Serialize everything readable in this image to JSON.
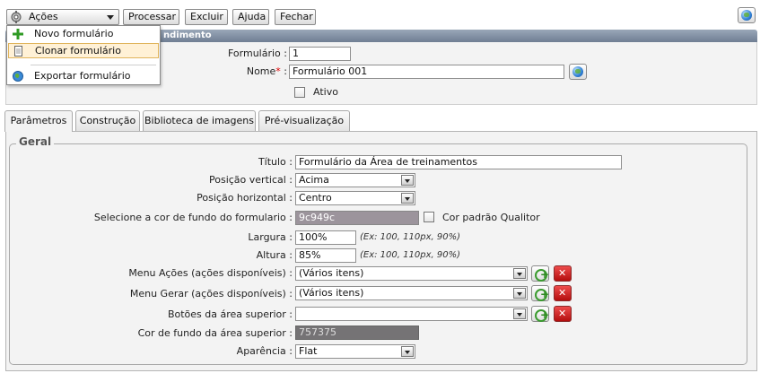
{
  "toolbar": {
    "acoes_label": "Ações",
    "processar_label": "Processar",
    "excluir_label": "Excluir",
    "ajuda_label": "Ajuda",
    "fechar_label": "Fechar"
  },
  "acoes_menu": {
    "items": [
      {
        "label": "Novo formulário",
        "icon": "plus-icon"
      },
      {
        "label": "Clonar formulário",
        "icon": "document-icon",
        "highlighted": true
      },
      {
        "label": "Exportar formulário",
        "icon": "globe-icon"
      }
    ]
  },
  "header": {
    "title": "ndimento"
  },
  "form": {
    "formulario_label": "Formulário :",
    "formulario_value": "1",
    "nome_label": "Nome",
    "nome_required": "*",
    "nome_suffix": " :",
    "nome_value": "Formulário 001",
    "ativo_label": "Ativo"
  },
  "tabs": [
    {
      "label": "Parâmetros",
      "active": true
    },
    {
      "label": "Construção"
    },
    {
      "label": "Biblioteca de imagens"
    },
    {
      "label": "Pré-visualização"
    }
  ],
  "geral": {
    "legend": "Geral",
    "titulo_label": "Título :",
    "titulo_value": "Formulário da Área de treinamentos",
    "posicao_vertical_label": "Posição vertical :",
    "posicao_vertical_value": "Acima",
    "posicao_horizontal_label": "Posição horizontal :",
    "posicao_horizontal_value": "Centro",
    "cor_fundo_label": "Selecione a cor de fundo do formulario :",
    "cor_fundo_value": "9c949c",
    "cor_padrao_label": "Cor padrão Qualitor",
    "largura_label": "Largura :",
    "largura_value": "100%",
    "largura_hint": "(Ex: 100, 110px, 90%)",
    "altura_label": "Altura :",
    "altura_value": "85%",
    "altura_hint": "(Ex: 100, 110px, 90%)",
    "menu_acoes_label": "Menu Ações (ações disponíveis) :",
    "menu_acoes_value": "(Vários itens)",
    "menu_gerar_label": "Menu Gerar (ações disponíveis) :",
    "menu_gerar_value": "(Vários itens)",
    "botoes_label": "Botões da área superior :",
    "botoes_value": "",
    "cor_area_label": "Cor de fundo da área superior :",
    "cor_area_value": "757375",
    "aparencia_label": "Aparência :",
    "aparencia_value": "Flat"
  },
  "colors": {
    "form_bg": "#9c949c",
    "area_bg": "#757375",
    "header_bar": "#7f8da1",
    "required": "#dd0000"
  }
}
